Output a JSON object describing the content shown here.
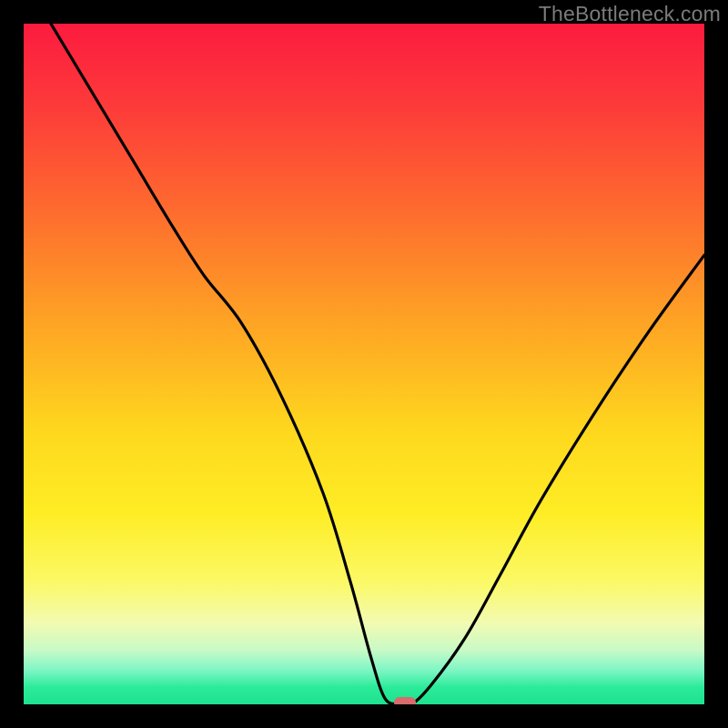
{
  "watermark": "TheBottleneck.com",
  "colors": {
    "background": "#000000",
    "curve_stroke": "#000000",
    "marker": "#d86b6c",
    "watermark": "#7b7b7b"
  },
  "chart_data": {
    "type": "line",
    "title": "",
    "xlabel": "",
    "ylabel": "",
    "xlim": [
      0,
      100
    ],
    "ylim": [
      0,
      100
    ],
    "legend": false,
    "grid": false,
    "axes_visible": false,
    "series": [
      {
        "name": "bottleneck-curve",
        "x": [
          4,
          10,
          16,
          22,
          26.5,
          32,
          38,
          44,
          48,
          51,
          53,
          55,
          57,
          60,
          65,
          70,
          76,
          84,
          92,
          100
        ],
        "values": [
          100,
          90,
          80,
          70,
          63,
          56,
          45,
          31,
          18,
          7,
          1,
          0,
          0,
          3,
          10,
          19,
          30,
          43,
          55,
          66
        ]
      }
    ],
    "marker": {
      "x": 56,
      "y": 0,
      "width_pct": 3.2,
      "height_pct": 1.5
    },
    "background_gradient": {
      "direction": "vertical",
      "stops": [
        {
          "pct": 0,
          "color": "#fc1b3f"
        },
        {
          "pct": 12,
          "color": "#fd3a3a"
        },
        {
          "pct": 28,
          "color": "#fe6d2e"
        },
        {
          "pct": 44,
          "color": "#fea424"
        },
        {
          "pct": 60,
          "color": "#fed81e"
        },
        {
          "pct": 72,
          "color": "#feed25"
        },
        {
          "pct": 82,
          "color": "#fbf966"
        },
        {
          "pct": 88,
          "color": "#f2fbb1"
        },
        {
          "pct": 92,
          "color": "#c9fac6"
        },
        {
          "pct": 95,
          "color": "#7ef6c5"
        },
        {
          "pct": 97.5,
          "color": "#2beb99"
        },
        {
          "pct": 100,
          "color": "#1de28f"
        }
      ]
    }
  }
}
